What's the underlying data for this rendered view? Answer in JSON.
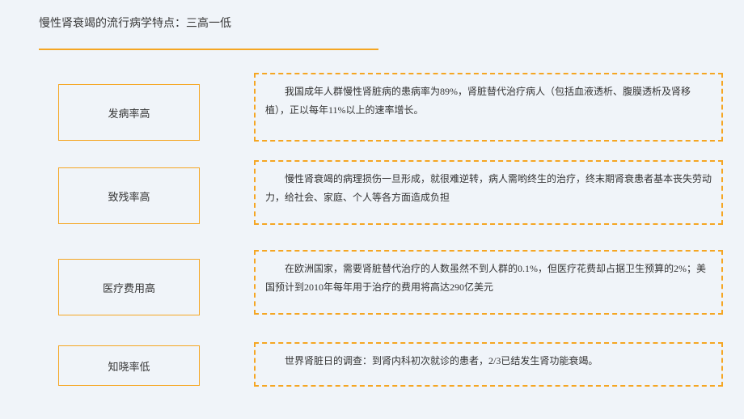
{
  "page_title": "慢性肾衰竭的流行病学特点：三高一低",
  "items": [
    {
      "label": "发病率高",
      "desc": "　　我国成年人群慢性肾脏病的患病率为89%，肾脏替代治疗病人（包括血液透析、腹膜透析及肾移植），正以每年11%以上的速率增长。"
    },
    {
      "label": "致残率高",
      "desc": "　　慢性肾衰竭的病理损伤一旦形成，就很难逆转，病人需哟终生的治疗，终末期肾衰患者基本丧失劳动力，给社会、家庭、个人等各方面造成负担"
    },
    {
      "label": "医疗费用高",
      "desc": "　　在欧洲国家，需要肾脏替代治疗的人数虽然不到人群的0.1%，但医疗花费却占据卫生预算的2%；美国预计到2010年每年用于治疗的费用将高达290亿美元"
    },
    {
      "label": "知晓率低",
      "desc": "　　世界肾脏日的调查：到肾内科初次就诊的患者，2/3已结发生肾功能衰竭。"
    }
  ]
}
